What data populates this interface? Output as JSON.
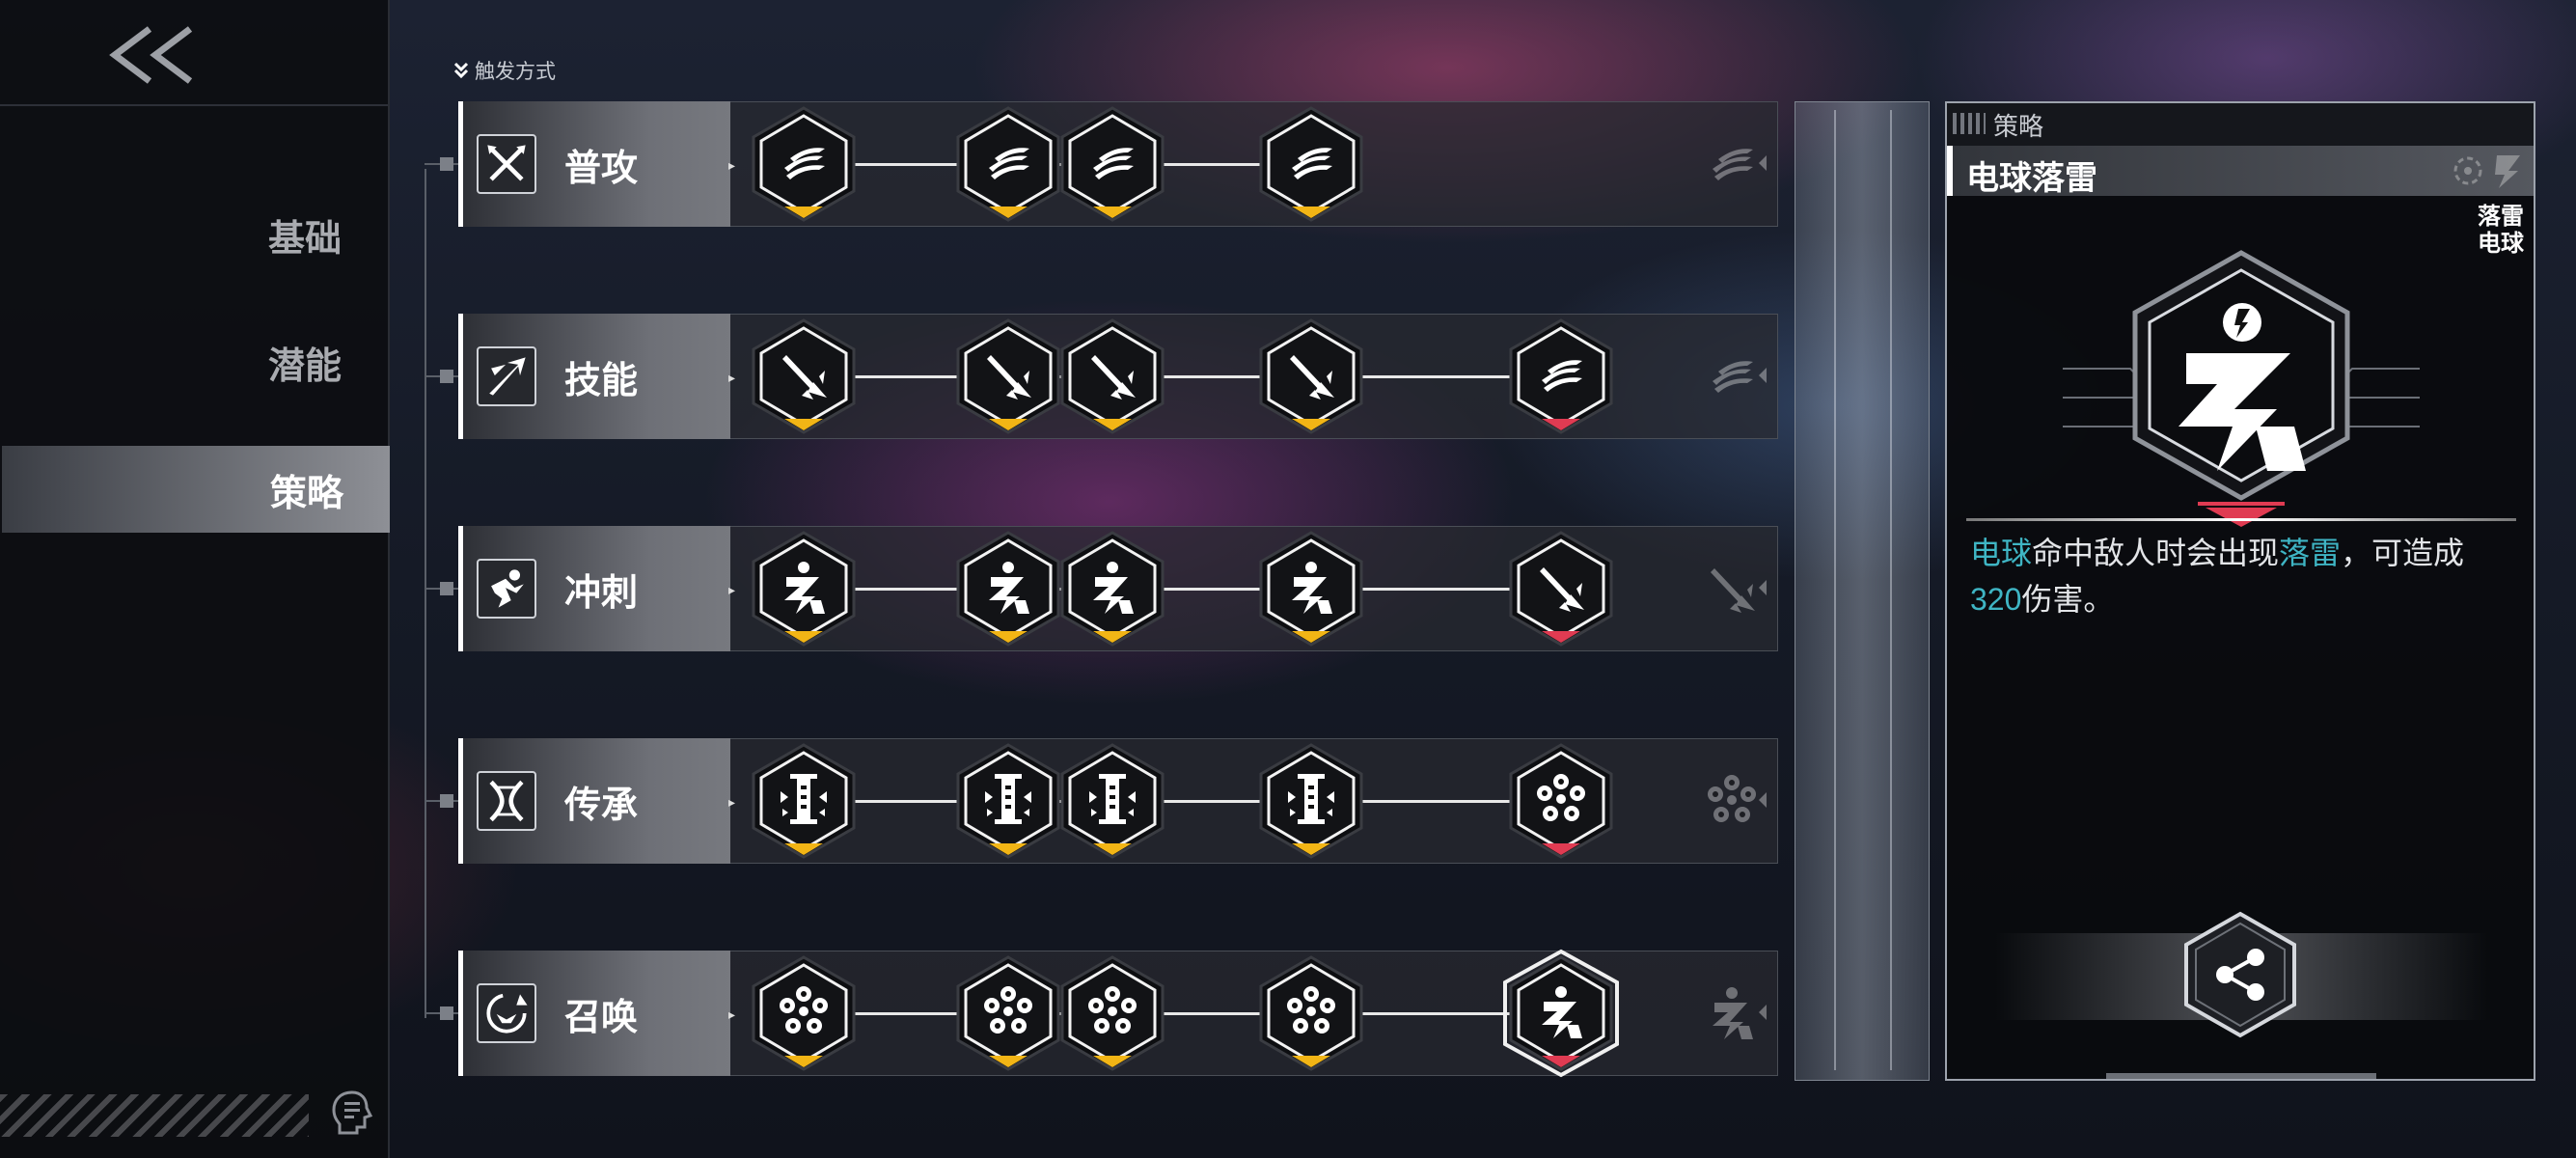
{
  "nav": {
    "back_icon": "double-chevron-left-icon",
    "items": [
      {
        "label": "基础",
        "active": false
      },
      {
        "label": "潜能",
        "active": false
      },
      {
        "label": "策略",
        "active": true
      }
    ]
  },
  "trigger": {
    "label": "触发方式",
    "icon": "double-chevron-down-icon"
  },
  "rows": [
    {
      "label": "普攻",
      "icon": "crossed-swords-icon",
      "nodes": [
        {
          "glyph": "claw-slash",
          "mark": "gold"
        },
        {
          "glyph": "claw-slash",
          "mark": "gold"
        },
        {
          "glyph": "claw-slash",
          "mark": "gold"
        },
        {
          "glyph": "claw-slash",
          "mark": "gold"
        }
      ]
    },
    {
      "label": "技能",
      "icon": "arrow-burst-icon",
      "nodes": [
        {
          "glyph": "spear",
          "mark": "gold"
        },
        {
          "glyph": "spear",
          "mark": "gold"
        },
        {
          "glyph": "spear",
          "mark": "gold"
        },
        {
          "glyph": "spear",
          "mark": "gold"
        },
        {
          "glyph": "claw-slash",
          "mark": "red"
        }
      ]
    },
    {
      "label": "冲刺",
      "icon": "dash-runner-icon",
      "nodes": [
        {
          "glyph": "lightning",
          "mark": "gold"
        },
        {
          "glyph": "lightning",
          "mark": "gold"
        },
        {
          "glyph": "lightning",
          "mark": "gold"
        },
        {
          "glyph": "lightning",
          "mark": "gold"
        },
        {
          "glyph": "spear",
          "mark": "red"
        }
      ]
    },
    {
      "label": "传承",
      "icon": "dna-helix-icon",
      "nodes": [
        {
          "glyph": "pillar",
          "mark": "gold"
        },
        {
          "glyph": "pillar",
          "mark": "gold"
        },
        {
          "glyph": "pillar",
          "mark": "gold"
        },
        {
          "glyph": "pillar",
          "mark": "gold"
        },
        {
          "glyph": "orb-ring",
          "mark": "red"
        }
      ]
    },
    {
      "label": "召唤",
      "icon": "summon-swirl-icon",
      "nodes": [
        {
          "glyph": "orb-ring",
          "mark": "gold"
        },
        {
          "glyph": "orb-ring",
          "mark": "gold"
        },
        {
          "glyph": "orb-ring",
          "mark": "gold"
        },
        {
          "glyph": "orb-ring",
          "mark": "gold"
        },
        {
          "glyph": "lightning",
          "mark": "red",
          "selected": true
        }
      ]
    }
  ],
  "detail": {
    "tab_label": "策略",
    "title": "电球落雷",
    "tags": [
      "落雷",
      "电球"
    ],
    "desc": {
      "kw1": "电球",
      "text1": "命中敌人时会出现",
      "kw2": "落雷",
      "text2": "，可造成",
      "value": "320",
      "text3": "伤害。"
    },
    "share_icon": "share-icon"
  },
  "colors": {
    "gold": "#f2b515",
    "red": "#e03b52",
    "highlight": "#3fb5c4",
    "accent_white": "#ffffff"
  }
}
